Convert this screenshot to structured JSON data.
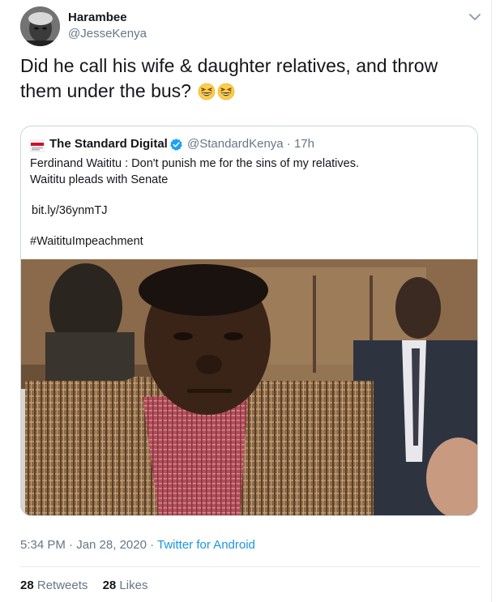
{
  "author": {
    "display_name": "Harambee",
    "handle": "@JesseKenya"
  },
  "tweet": {
    "text_line1": "Did he call his wife & daughter relatives, and throw",
    "text_line2": "them under the bus?",
    "emoji": [
      "grinning-squinting-face-emoji",
      "grinning-squinting-face-emoji"
    ]
  },
  "quoted": {
    "display_name": "The Standard Digital",
    "handle_time": "@StandardKenya · 17h",
    "line1": "Ferdinand Waititu : Don't punish me for the sins of my relatives.",
    "line2": "Waititu pleads with Senate",
    "link": "bit.ly/36ynmTJ",
    "hashtag": "#WaitituImpeachment"
  },
  "footer": {
    "time_date": "5:34 PM · Jan 28, 2020 · ",
    "source": "Twitter for Android",
    "retweets_count": "28",
    "retweets_label": "Retweets",
    "likes_count": "28",
    "likes_label": "Likes"
  },
  "colors": {
    "text": "#14171a",
    "secondary": "#657786",
    "link": "#1b95e0",
    "border": "#ccd6dd"
  }
}
